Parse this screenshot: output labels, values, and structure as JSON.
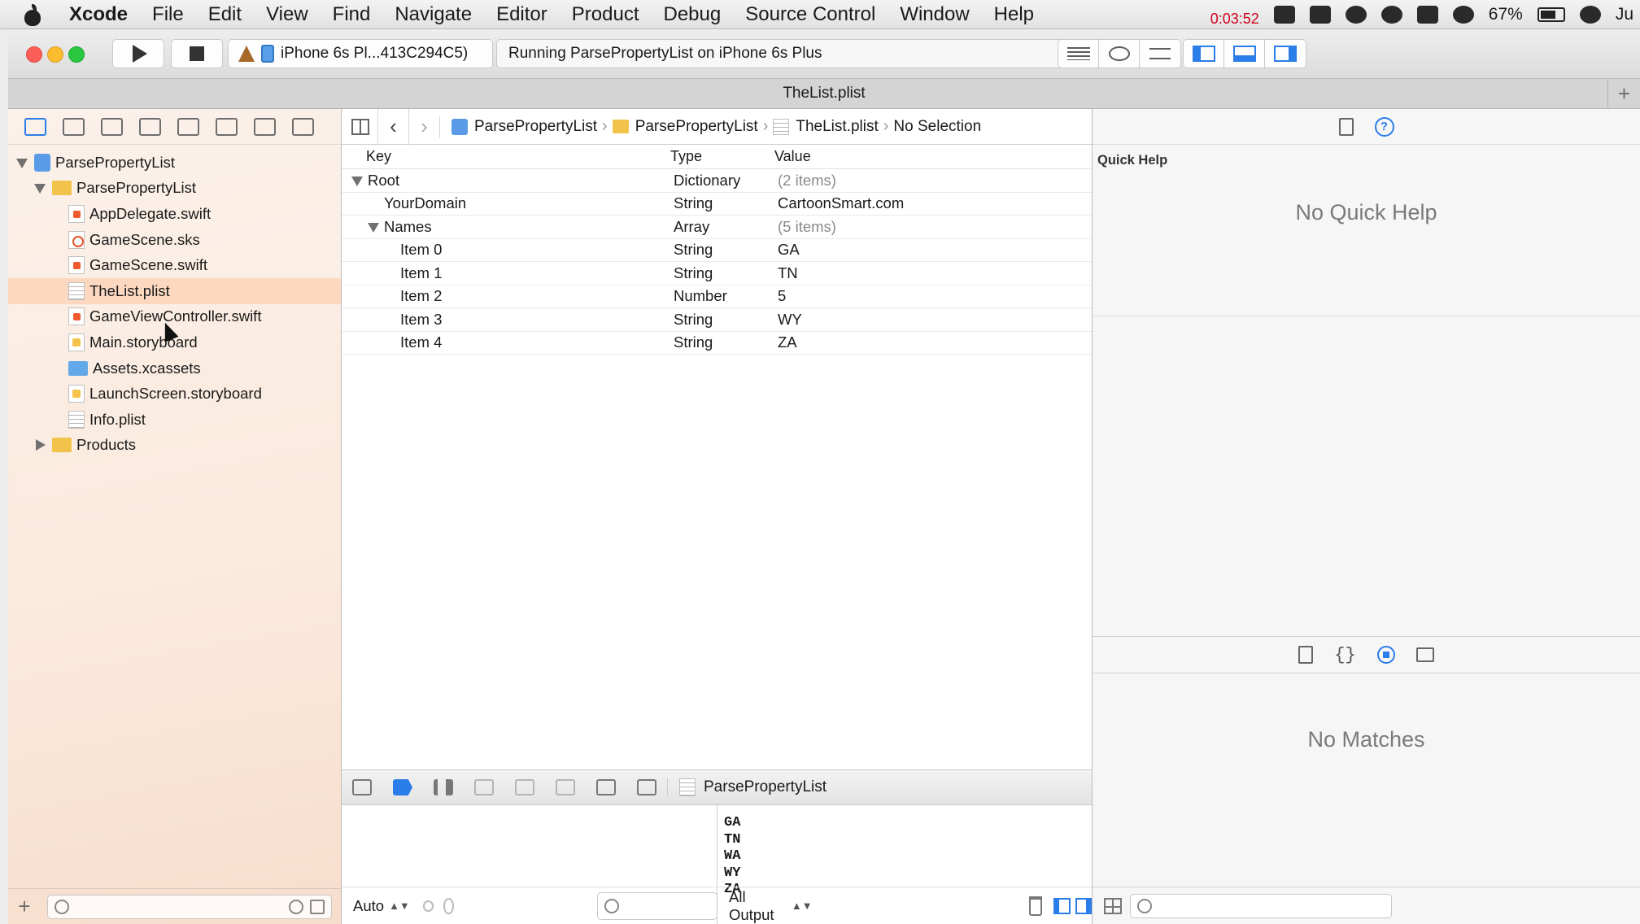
{
  "menubar": {
    "app_name": "Xcode",
    "items": [
      "File",
      "Edit",
      "View",
      "Find",
      "Navigate",
      "Editor",
      "Product",
      "Debug",
      "Source Control",
      "Window",
      "Help"
    ],
    "timer": "0:03:52",
    "battery": "67%",
    "user_fragment": "Ju"
  },
  "toolbar": {
    "scheme_device": "iPhone 6s Pl...413C294C5)",
    "activity": "Running ParsePropertyList on iPhone 6s Plus"
  },
  "tab": {
    "title": "TheList.plist"
  },
  "navigator": {
    "items": [
      {
        "label": "ParsePropertyList",
        "icon": "project-icon",
        "disclosure": "open"
      },
      {
        "label": "ParsePropertyList",
        "icon": "folder-icon",
        "disclosure": "open"
      },
      {
        "label": "AppDelegate.swift",
        "icon": "swift-file-icon"
      },
      {
        "label": "GameScene.sks",
        "icon": "sks-file-icon"
      },
      {
        "label": "GameScene.swift",
        "icon": "swift-file-icon"
      },
      {
        "label": "TheList.plist",
        "icon": "plist-file-icon",
        "selected": true
      },
      {
        "label": "GameViewController.swift",
        "icon": "swift-file-icon"
      },
      {
        "label": "Main.storyboard",
        "icon": "storyboard-file-icon"
      },
      {
        "label": "Assets.xcassets",
        "icon": "assets-folder-icon"
      },
      {
        "label": "LaunchScreen.storyboard",
        "icon": "storyboard-file-icon"
      },
      {
        "label": "Info.plist",
        "icon": "plist-file-icon"
      },
      {
        "label": "Products",
        "icon": "folder-icon",
        "disclosure": "closed"
      }
    ]
  },
  "jumpbar": {
    "crumbs": [
      "ParsePropertyList",
      "ParsePropertyList",
      "TheList.plist"
    ],
    "selection": "No Selection"
  },
  "plist": {
    "headers": {
      "key": "Key",
      "type": "Type",
      "value": "Value"
    },
    "rows": [
      {
        "key": "Root",
        "type": "Dictionary",
        "value": "(2 items)"
      },
      {
        "key": "YourDomain",
        "type": "String",
        "value": "CartoonSmart.com"
      },
      {
        "key": "Names",
        "type": "Array",
        "value": "(5 items)"
      },
      {
        "key": "Item 0",
        "type": "String",
        "value": "GA"
      },
      {
        "key": "Item 1",
        "type": "String",
        "value": "TN"
      },
      {
        "key": "Item 2",
        "type": "Number",
        "value": "5"
      },
      {
        "key": "Item 3",
        "type": "String",
        "value": "WY"
      },
      {
        "key": "Item 4",
        "type": "String",
        "value": "ZA"
      }
    ]
  },
  "debug": {
    "process": "ParsePropertyList",
    "scope": "Auto",
    "output_scope": "All Output",
    "console_lines": [
      "GA",
      "TN",
      "WA",
      "WY",
      "ZA"
    ]
  },
  "utilities": {
    "quick_help_title": "Quick Help",
    "quick_help_empty": "No Quick Help",
    "library_empty": "No Matches"
  }
}
